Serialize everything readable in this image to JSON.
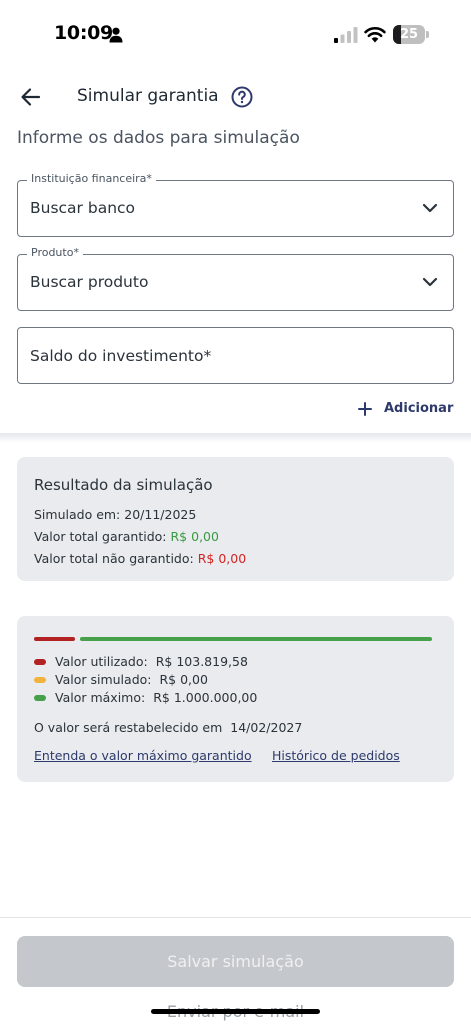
{
  "status_bar": {
    "time": "10:09",
    "battery": "25",
    "battery_level": 0.25
  },
  "header": {
    "title": "Simular garantia",
    "subtitle": "Informe os dados para simulação"
  },
  "form": {
    "institution": {
      "label": "Instituição financeira*",
      "value": "Buscar banco"
    },
    "product": {
      "label": "Produto*",
      "value": "Buscar produto"
    },
    "balance": {
      "placeholder": "Saldo do investimento*"
    },
    "add_label": "Adicionar"
  },
  "result": {
    "title": "Resultado da simulação",
    "simulated_label": "Simulado em:",
    "simulated_date": "20/11/2025",
    "guaranteed_label": "Valor total garantido:",
    "guaranteed_value": "R$ 0,00",
    "not_guaranteed_label": "Valor total não garantido:",
    "not_guaranteed_value": "R$ 0,00",
    "colors": {
      "positive": "#3a9a43",
      "negative": "#d02525"
    }
  },
  "limit": {
    "used_fraction": 0.103819,
    "legend": [
      {
        "label": "Valor utilizado:",
        "value": "R$ 103.819,58",
        "color": "#b22222"
      },
      {
        "label": "Valor simulado:",
        "value": "R$ 0,00",
        "color": "#f0b43c"
      },
      {
        "label": "Valor máximo:",
        "value": "R$ 1.000.000,00",
        "color": "#45a049"
      }
    ],
    "restore_text": "O valor será restabelecido em",
    "restore_date": "14/02/2027",
    "link_max": "Entenda o valor máximo garantido",
    "link_history": "Histórico de pedidos"
  },
  "footer": {
    "save_label": "Salvar simulação",
    "email_label": "Enviar por e-mail"
  }
}
